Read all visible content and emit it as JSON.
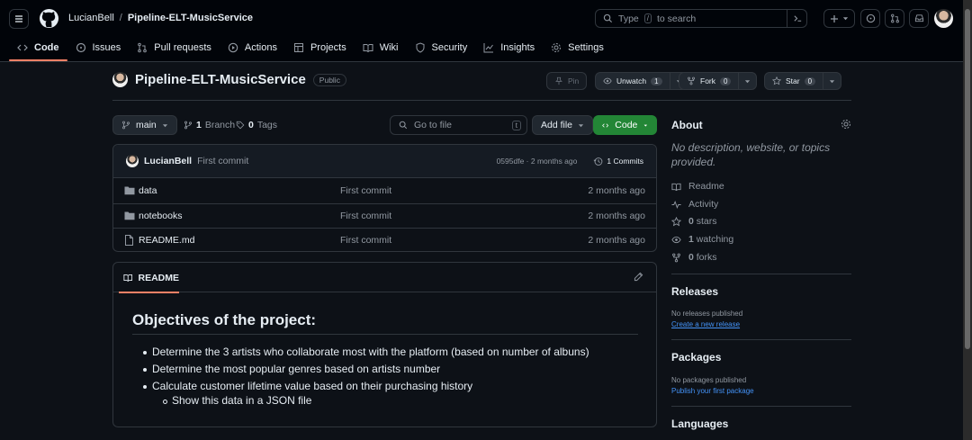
{
  "header": {
    "owner": "LucianBell",
    "separator": "/",
    "repo": "Pipeline-ELT-MusicService",
    "search_prefix": "Type",
    "search_key": "/",
    "search_suffix": "to search"
  },
  "tabs": [
    {
      "label": "Code"
    },
    {
      "label": "Issues"
    },
    {
      "label": "Pull requests"
    },
    {
      "label": "Actions"
    },
    {
      "label": "Projects"
    },
    {
      "label": "Wiki"
    },
    {
      "label": "Security"
    },
    {
      "label": "Insights"
    },
    {
      "label": "Settings"
    }
  ],
  "repo": {
    "name": "Pipeline-ELT-MusicService",
    "visibility": "Public",
    "pin": "Pin",
    "unwatch": "Unwatch",
    "watch_count": "1",
    "fork": "Fork",
    "fork_count": "0",
    "star": "Star",
    "star_count": "0"
  },
  "toolbar": {
    "branch": "main",
    "branch_count": "1",
    "branch_label": "Branch",
    "tag_count": "0",
    "tag_label": "Tags",
    "go_to_file": "Go to file",
    "go_to_file_key": "t",
    "add_file": "Add file",
    "code": "Code"
  },
  "commit": {
    "user": "LucianBell",
    "message": "First commit",
    "meta": "0595dfe · 2 months ago",
    "commits": "1 Commits"
  },
  "files": [
    {
      "name": "data",
      "message": "First commit",
      "date": "2 months ago"
    },
    {
      "name": "notebooks",
      "message": "First commit",
      "date": "2 months ago"
    },
    {
      "name": "README.md",
      "message": "First commit",
      "date": "2 months ago"
    }
  ],
  "readme": {
    "tab": "README",
    "heading": "Objectives of the project:",
    "bullets": [
      "Determine the 3 artists who collaborate most with the platform (based on number of albuns)",
      "Determine the most popular genres based on artists number",
      "Calculate customer lifetime value based on their purchasing history"
    ],
    "sub_bullet": "Show this data in a JSON file"
  },
  "about": {
    "title": "About",
    "description": "No description, website, or topics provided.",
    "readme": "Readme",
    "activity": "Activity",
    "stars_count": "0",
    "stars": "stars",
    "watching_count": "1",
    "watching": "watching",
    "forks_count": "0",
    "forks": "forks"
  },
  "releases": {
    "title": "Releases",
    "none": "No releases published",
    "create": "Create a new release"
  },
  "packages": {
    "title": "Packages",
    "none": "No packages published",
    "publish": "Publish your first package"
  },
  "languages": {
    "title": "Languages"
  }
}
